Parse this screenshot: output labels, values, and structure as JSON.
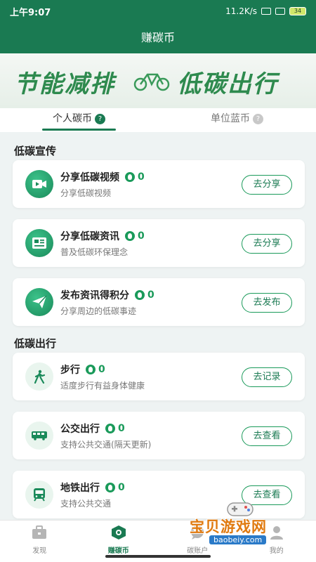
{
  "status_bar": {
    "time": "上午9:07",
    "speed": "11.2K/s",
    "battery": "34"
  },
  "header": {
    "title": "赚碳币"
  },
  "banner": {
    "left_text": "节能减排",
    "right_text": "低碳出行"
  },
  "tabs": [
    {
      "label": "个人碳币",
      "help": "?"
    },
    {
      "label": "单位蓝币",
      "help": "?"
    }
  ],
  "sections": {
    "promo": {
      "title": "低碳宣传"
    },
    "travel": {
      "title": "低碳出行"
    }
  },
  "cards": [
    {
      "title": "分享低碳视频",
      "points": "0",
      "desc": "分享低碳视频",
      "button": "去分享",
      "icon": "video-icon"
    },
    {
      "title": "分享低碳资讯",
      "points": "0",
      "desc": "普及低碳环保理念",
      "button": "去分享",
      "icon": "news-icon"
    },
    {
      "title": "发布资讯得积分",
      "points": "0",
      "desc": "分享周边的低碳事迹",
      "button": "去发布",
      "icon": "send-icon"
    },
    {
      "title": "步行",
      "points": "0",
      "desc": "适度步行有益身体健康",
      "button": "去记录",
      "icon": "walk-icon"
    },
    {
      "title": "公交出行",
      "points": "0",
      "desc": "支持公共交通(隔天更新)",
      "button": "去查看",
      "icon": "bus-icon"
    },
    {
      "title": "地铁出行",
      "points": "0",
      "desc": "支持公共交通",
      "button": "去查看",
      "icon": "subway-icon"
    }
  ],
  "bottom_nav": [
    {
      "label": "发现",
      "icon": "briefcase-icon"
    },
    {
      "label": "赚碳币",
      "icon": "hexagon-icon"
    },
    {
      "label": "碳账户",
      "icon": "chat-icon"
    },
    {
      "label": "我的",
      "icon": "user-icon"
    }
  ],
  "watermark": {
    "line1": "宝贝游戏网",
    "line2": "baobeiy.com"
  },
  "colors": {
    "primary": "#1a7a52",
    "accent": "#1a9a5a",
    "background": "#eef3f3"
  }
}
